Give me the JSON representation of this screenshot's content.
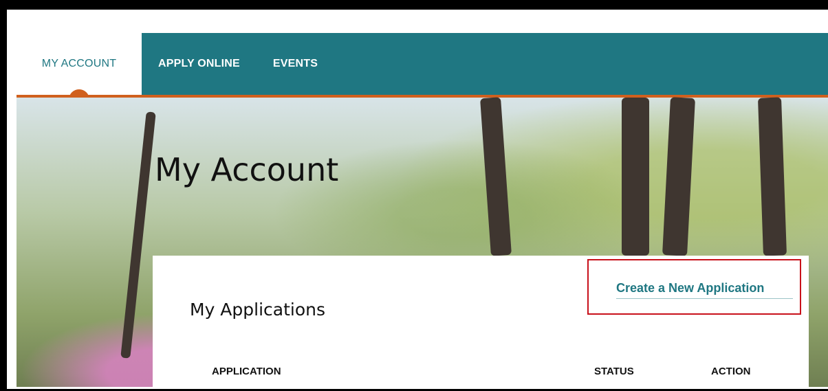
{
  "nav": {
    "items": [
      {
        "label": "MY ACCOUNT",
        "active": true
      },
      {
        "label": "APPLY ONLINE",
        "active": false
      },
      {
        "label": "EVENTS",
        "active": false
      }
    ]
  },
  "hero": {
    "title": "My Account"
  },
  "applications": {
    "title": "My Applications",
    "create_link_label": "Create a New Application",
    "columns": [
      "APPLICATION",
      "STATUS",
      "ACTION"
    ]
  },
  "colors": {
    "brand_teal": "#1f7782",
    "accent_orange": "#d0601e",
    "highlight_red": "#c8101a"
  }
}
